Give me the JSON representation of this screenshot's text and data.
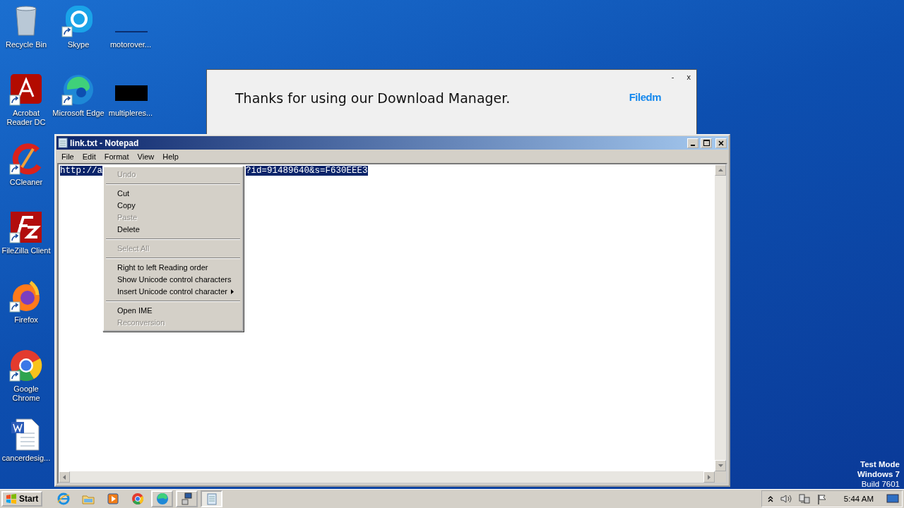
{
  "desktop_icons": [
    {
      "label": "Recycle Bin",
      "kind": "recycle",
      "shortcut": false
    },
    {
      "label": "Skype",
      "kind": "skype",
      "shortcut": true
    },
    {
      "label": "motorover...",
      "kind": "blank-line",
      "shortcut": false
    },
    {
      "label": "Acrobat Reader DC",
      "kind": "acrobat",
      "shortcut": true
    },
    {
      "label": "Microsoft Edge",
      "kind": "edge",
      "shortcut": true
    },
    {
      "label": "multipleres...",
      "kind": "black",
      "shortcut": false
    },
    {
      "label": "CCleaner",
      "kind": "ccleaner",
      "shortcut": true
    },
    {
      "label": "FileZilla Client",
      "kind": "filezilla",
      "shortcut": true
    },
    {
      "label": "Firefox",
      "kind": "firefox",
      "shortcut": true
    },
    {
      "label": "Google Chrome",
      "kind": "chrome",
      "shortcut": true
    },
    {
      "label": "cancerdesig...",
      "kind": "word",
      "shortcut": false
    }
  ],
  "popup": {
    "message": "Thanks for using our Download Manager.",
    "logo": "Filedm",
    "buttons": [
      "-",
      "x"
    ]
  },
  "notepad": {
    "title": "link.txt - Notepad",
    "menu": [
      "File",
      "Edit",
      "Format",
      "View",
      "Help"
    ],
    "text_parts": [
      "http://a",
      "?id=91489640&s=F630EEE3"
    ],
    "selected": true
  },
  "context_menu": {
    "groups": [
      [
        {
          "label": "Undo",
          "disabled": true,
          "submenu": false
        }
      ],
      [
        {
          "label": "Cut",
          "disabled": false,
          "submenu": false
        },
        {
          "label": "Copy",
          "disabled": false,
          "submenu": false
        },
        {
          "label": "Paste",
          "disabled": true,
          "submenu": false
        },
        {
          "label": "Delete",
          "disabled": false,
          "submenu": false
        }
      ],
      [
        {
          "label": "Select All",
          "disabled": true,
          "submenu": false
        }
      ],
      [
        {
          "label": "Right to left Reading order",
          "disabled": false,
          "submenu": false
        },
        {
          "label": "Show Unicode control characters",
          "disabled": false,
          "submenu": false
        },
        {
          "label": "Insert Unicode control character",
          "disabled": false,
          "submenu": true
        }
      ],
      [
        {
          "label": "Open IME",
          "disabled": false,
          "submenu": false
        },
        {
          "label": "Reconversion",
          "disabled": true,
          "submenu": false
        }
      ]
    ]
  },
  "system_note": [
    "Test Mode",
    "Windows 7",
    "Build 7601"
  ],
  "taskbar": {
    "start": "Start",
    "apps": [
      {
        "kind": "ie",
        "running": false,
        "active": false
      },
      {
        "kind": "explorer",
        "running": false,
        "active": false
      },
      {
        "kind": "media",
        "running": false,
        "active": false
      },
      {
        "kind": "chrome",
        "running": false,
        "active": false
      },
      {
        "kind": "edge",
        "running": true,
        "active": false
      },
      {
        "kind": "app",
        "running": true,
        "active": false
      },
      {
        "kind": "notepad",
        "running": true,
        "active": true
      }
    ],
    "clock": "5:44 AM"
  }
}
